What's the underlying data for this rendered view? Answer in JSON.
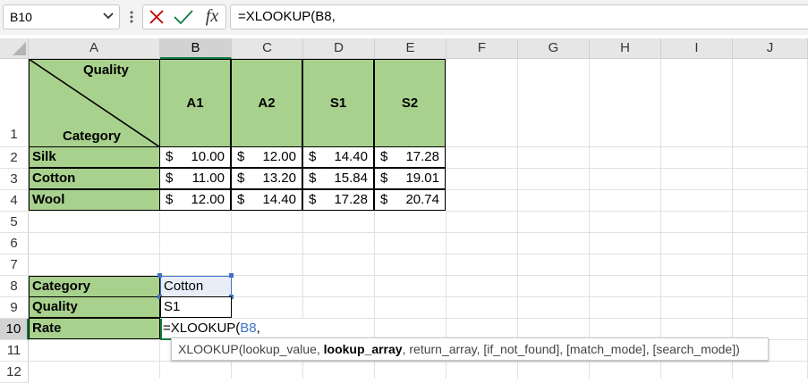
{
  "formula_bar": {
    "name_box": "B10",
    "fx_label": "fx",
    "formula": "=XLOOKUP(B8,"
  },
  "columns": [
    {
      "label": "A",
      "width": 147
    },
    {
      "label": "B",
      "width": 80
    },
    {
      "label": "C",
      "width": 80
    },
    {
      "label": "D",
      "width": 80
    },
    {
      "label": "E",
      "width": 80
    },
    {
      "label": "F",
      "width": 80
    },
    {
      "label": "G",
      "width": 80
    },
    {
      "label": "H",
      "width": 80
    },
    {
      "label": "I",
      "width": 80
    },
    {
      "label": "J",
      "width": 84
    }
  ],
  "rows": [
    "1",
    "2",
    "3",
    "4",
    "5",
    "6",
    "7",
    "8",
    "9",
    "10",
    "11",
    "12"
  ],
  "selected": {
    "column": "B",
    "row": "10"
  },
  "header_cell": {
    "top_label": "Quality",
    "bottom_label": "Category"
  },
  "quality_headers": [
    "A1",
    "A2",
    "S1",
    "S2"
  ],
  "rate_table": [
    {
      "category": "Silk",
      "values": [
        "10.00",
        "12.00",
        "14.40",
        "17.28"
      ]
    },
    {
      "category": "Cotton",
      "values": [
        "11.00",
        "13.20",
        "15.84",
        "19.01"
      ]
    },
    {
      "category": "Wool",
      "values": [
        "12.00",
        "14.40",
        "17.28",
        "20.74"
      ]
    }
  ],
  "currency_symbol": "$",
  "lookup": {
    "category_label": "Category",
    "category_value": "Cotton",
    "quality_label": "Quality",
    "quality_value": "S1",
    "rate_label": "Rate",
    "rate_formula_prefix": "=XLOOKUP(",
    "rate_formula_ref": "B8",
    "rate_formula_suffix": ","
  },
  "tooltip": {
    "function": "XLOOKUP(",
    "arg1": "lookup_value, ",
    "arg_current": "lookup_array",
    "rest": ", return_array, [if_not_found], [match_mode], [search_mode])"
  },
  "colors": {
    "green_fill": "#a9d18e",
    "excel_green": "#107c41",
    "ref_blue": "#4472c4",
    "cancel_red": "#c00000",
    "enter_green": "#107c41"
  }
}
